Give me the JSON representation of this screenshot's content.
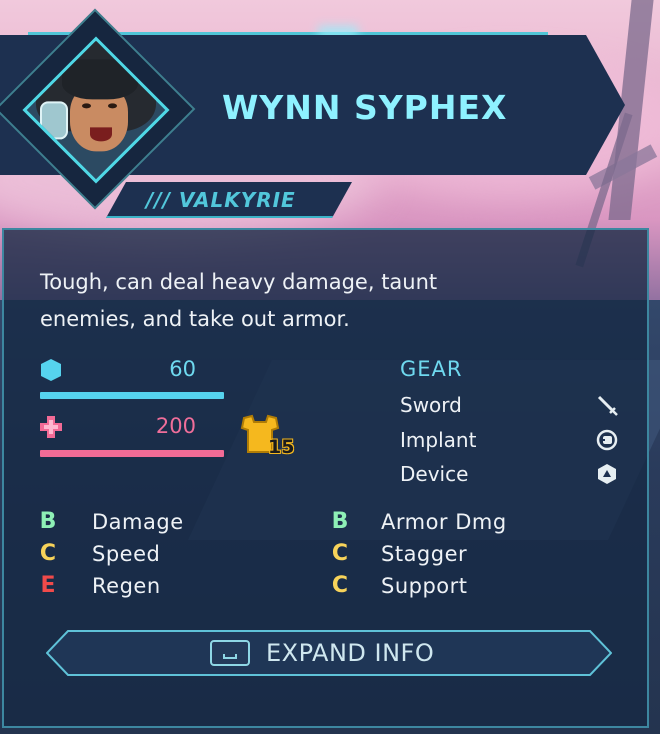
{
  "character": {
    "name": "WYNN SYPHEX",
    "class_label": "/// VALKYRIE",
    "description_lines": [
      "Tough, can deal heavy damage, taunt",
      "enemies, and take out armor."
    ]
  },
  "stats": {
    "armor": {
      "value": "60",
      "fraction": 1.0,
      "color": "#56d3ee"
    },
    "health": {
      "value": "200",
      "fraction": 1.0,
      "color": "#f26b96"
    },
    "armor_badge": {
      "value": "15",
      "color": "#f5b81e"
    }
  },
  "gear": {
    "title": "GEAR",
    "items": [
      {
        "label": "Sword",
        "icon": "sword-icon"
      },
      {
        "label": "Implant",
        "icon": "implant-icon"
      },
      {
        "label": "Device",
        "icon": "device-icon"
      }
    ]
  },
  "ratings": {
    "left": [
      {
        "grade": "B",
        "label": "Damage",
        "color": "#8ef0b6"
      },
      {
        "grade": "C",
        "label": "Speed",
        "color": "#f7d35a"
      },
      {
        "grade": "E",
        "label": "Regen",
        "color": "#f04a4a"
      }
    ],
    "right": [
      {
        "grade": "B",
        "label": "Armor Dmg",
        "color": "#8ef0b6"
      },
      {
        "grade": "C",
        "label": "Stagger",
        "color": "#f7d35a"
      },
      {
        "grade": "C",
        "label": "Support",
        "color": "#f7d35a"
      }
    ]
  },
  "actions": {
    "expand_label": "EXPAND INFO"
  },
  "colors": {
    "accent": "#8ef1ff",
    "panel": "#162944",
    "border": "#3d87a0"
  }
}
